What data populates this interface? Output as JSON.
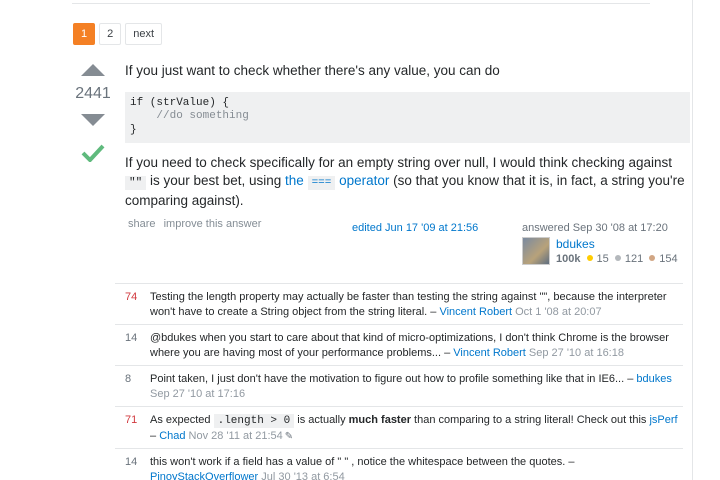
{
  "pager": {
    "pages": [
      "1",
      "2"
    ],
    "next_label": "next"
  },
  "vote": {
    "count": "2441"
  },
  "answer": {
    "p1": "If you just want to check whether there's any value, you can do",
    "code_line1": "if (strValue) {",
    "code_line2": "    //do something",
    "code_line3": "}",
    "p2_a": "If you need to check specifically for an empty string over null, I would think checking against ",
    "p2_code1": "\"\"",
    "p2_b": " is your best bet, using ",
    "p2_link_a": "the ",
    "p2_code2": "===",
    "p2_link_b": " operator",
    "p2_c": " (so that you know that it is, in fact, a string you're comparing against)."
  },
  "menu": {
    "share": "share",
    "improve": "improve this answer"
  },
  "edited": "edited Jun 17 '09 at 21:56",
  "answered": "answered Sep 30 '08 at 17:20",
  "user": {
    "name": "bdukes",
    "rep": "100k",
    "gold": "15",
    "silver": "121",
    "bronze": "154"
  },
  "colors": {
    "gold": "#ffcc01",
    "silver": "#b4b8bc",
    "bronze": "#d1a684",
    "accent": "#f48024",
    "link": "#0077cc",
    "accepted": "#5fba7d"
  },
  "comments": [
    {
      "score": "74",
      "text": "Testing the length property may actually be faster than testing the string against \"\", because the interpreter won't have to create a String object from the string literal. – ",
      "user": "Vincent Robert",
      "date": "Oct 1 '08 at 20:07"
    },
    {
      "score": "14",
      "text": "@bdukes when you start to care about that kind of micro-optimizations, I don't think Chrome is the browser where you are having most of your performance problems... – ",
      "user": "Vincent Robert",
      "date": "Sep 27 '10 at 16:18"
    },
    {
      "score": "8",
      "text": "Point taken, I just don't have the motivation to figure out how to profile something like that in IE6... – ",
      "user": "bdukes",
      "date": "Sep 27 '10 at 17:16"
    },
    {
      "score": "71",
      "text_a": "As expected ",
      "code": ".length > 0",
      "text_b": " is actually ",
      "bold": "much faster",
      "text_c": " than comparing to a string literal! Check out this ",
      "link": "jsPerf",
      "sep": " – ",
      "user": "Chad",
      "date": "Nov 28 '11 at 21:54"
    },
    {
      "score": "14",
      "text": "this won't work if a field has a value of \" \" , notice the whitespace between the quotes. – ",
      "user": "PinoyStackOverflower",
      "date": "Jul 30 '13 at 6:54"
    }
  ]
}
